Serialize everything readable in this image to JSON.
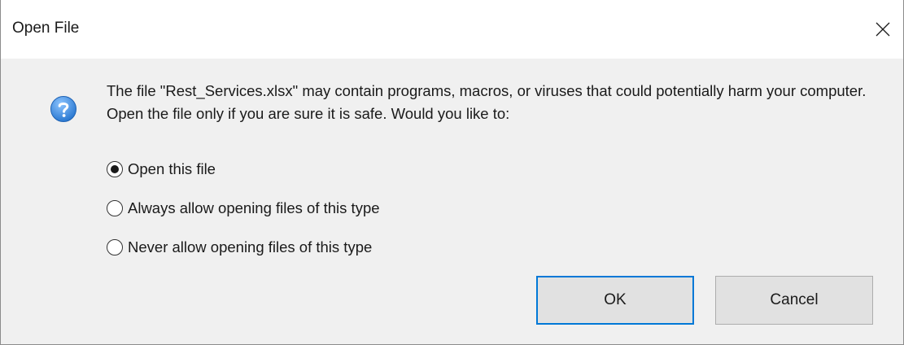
{
  "window": {
    "title": "Open File",
    "close_icon": "close-icon"
  },
  "message": {
    "icon": "question-icon",
    "text": "The file \"Rest_Services.xlsx\" may contain programs, macros, or viruses that could potentially harm your computer. Open the file only if you are sure it is safe. Would you like to:"
  },
  "options": [
    {
      "label": "Open this file",
      "selected": true
    },
    {
      "label": "Always allow opening files of this type",
      "selected": false
    },
    {
      "label": "Never allow opening files of this type",
      "selected": false
    }
  ],
  "buttons": {
    "ok_label": "OK",
    "cancel_label": "Cancel"
  },
  "colors": {
    "accent": "#0078d7",
    "question_icon": "#3b8fe0"
  }
}
